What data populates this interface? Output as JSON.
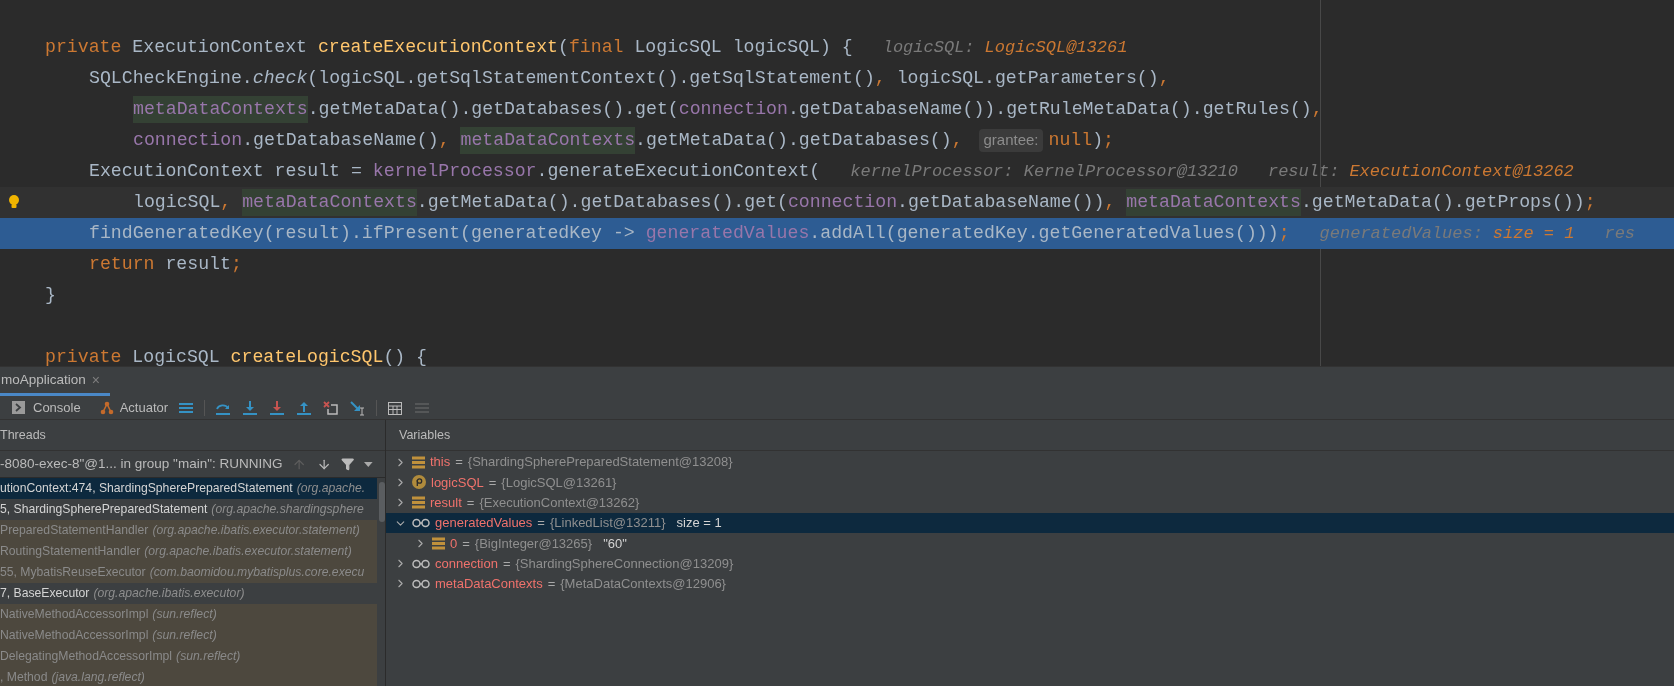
{
  "editor": {
    "lines": [
      {
        "kind": "top",
        "selected": false,
        "bulb": false,
        "tokens": [
          {
            "kind": "keyword",
            "text": "private "
          },
          {
            "kind": "plain",
            "text": "ExecutionContext "
          },
          {
            "kind": "declaration",
            "text": "createExecutionContext"
          },
          {
            "kind": "plain",
            "text": "("
          },
          {
            "kind": "keyword",
            "text": "final "
          },
          {
            "kind": "plain",
            "text": "LogicSQL logicSQL) {"
          },
          {
            "kind": "hint-label",
            "text": "logicSQL:"
          },
          {
            "kind": "hint-value",
            "text": "LogicSQL@13261"
          }
        ]
      },
      {
        "kind": "body",
        "selected": false,
        "bulb": false,
        "tokens": [
          {
            "kind": "plain",
            "text": "SQLCheckEngine."
          },
          {
            "kind": "static-call",
            "text": "check"
          },
          {
            "kind": "plain",
            "text": "(logicSQL.getSqlStatementContext().getSqlStatement()"
          },
          {
            "kind": "keyword",
            "text": ", "
          },
          {
            "kind": "plain",
            "text": "logicSQL.getParameters()"
          },
          {
            "kind": "keyword",
            "text": ","
          }
        ]
      },
      {
        "kind": "continuation",
        "selected": false,
        "bulb": false,
        "tokens": [
          {
            "kind": "field-usage",
            "text": "metaDataContexts"
          },
          {
            "kind": "plain",
            "text": ".getMetaData().getDatabases().get("
          },
          {
            "kind": "field",
            "text": "connection"
          },
          {
            "kind": "plain",
            "text": ".getDatabaseName()).getRuleMetaData().getRules()"
          },
          {
            "kind": "keyword",
            "text": ","
          }
        ]
      },
      {
        "kind": "continuation",
        "selected": false,
        "bulb": false,
        "tokens": [
          {
            "kind": "field",
            "text": "connection"
          },
          {
            "kind": "plain",
            "text": ".getDatabaseName()"
          },
          {
            "kind": "keyword",
            "text": ", "
          },
          {
            "kind": "field-usage",
            "text": "metaDataContexts"
          },
          {
            "kind": "plain",
            "text": ".getMetaData().getDatabases()"
          },
          {
            "kind": "keyword",
            "text": ", "
          },
          {
            "kind": "param-hint",
            "text": "grantee:"
          },
          {
            "kind": "keyword",
            "text": "null"
          },
          {
            "kind": "plain",
            "text": ")"
          },
          {
            "kind": "keyword",
            "text": ";"
          }
        ]
      },
      {
        "kind": "body",
        "selected": false,
        "bulb": false,
        "tokens": [
          {
            "kind": "plain",
            "text": "ExecutionContext result = "
          },
          {
            "kind": "field",
            "text": "kernelProcessor"
          },
          {
            "kind": "plain",
            "text": ".generateExecutionContext("
          },
          {
            "kind": "hint-label",
            "text": "kernelProcessor: KernelProcessor@13210"
          },
          {
            "kind": "hint-label",
            "text": "result:"
          },
          {
            "kind": "hint-value",
            "text": "ExecutionContext@13262"
          }
        ]
      },
      {
        "kind": "continuation",
        "selected": false,
        "bulb": true,
        "tokens": [
          {
            "kind": "plain",
            "text": "logicSQL"
          },
          {
            "kind": "keyword",
            "text": ", "
          },
          {
            "kind": "field-usage",
            "text": "metaDataContexts"
          },
          {
            "kind": "plain",
            "text": ".getMetaData().getDatabases().get("
          },
          {
            "kind": "field",
            "text": "connection"
          },
          {
            "kind": "plain",
            "text": ".getDatabaseName())"
          },
          {
            "kind": "keyword",
            "text": ", "
          },
          {
            "kind": "field-usage",
            "text": "metaDataContexts"
          },
          {
            "kind": "plain",
            "text": ".getMetaData().getProps())"
          },
          {
            "kind": "keyword",
            "text": ";"
          }
        ]
      },
      {
        "kind": "body",
        "selected": true,
        "bulb": false,
        "tokens": [
          {
            "kind": "plain",
            "text": "findGeneratedKey(result).ifPresent(generatedKey -> "
          },
          {
            "kind": "field",
            "text": "generatedValues"
          },
          {
            "kind": "plain",
            "text": ".addAll(generatedKey.getGeneratedValues()))"
          },
          {
            "kind": "keyword",
            "text": ";"
          },
          {
            "kind": "hint-label",
            "text": "generatedValues:"
          },
          {
            "kind": "hint-value",
            "text": "size = 1"
          },
          {
            "kind": "hint-label",
            "text": "res"
          }
        ]
      },
      {
        "kind": "body",
        "selected": false,
        "bulb": false,
        "tokens": [
          {
            "kind": "keyword",
            "text": "return "
          },
          {
            "kind": "plain",
            "text": "result"
          },
          {
            "kind": "keyword",
            "text": ";"
          }
        ]
      },
      {
        "kind": "top",
        "selected": false,
        "bulb": false,
        "tokens": [
          {
            "kind": "plain",
            "text": "}"
          }
        ]
      },
      {
        "kind": "top",
        "selected": false,
        "bulb": false
      },
      {
        "kind": "top",
        "selected": false,
        "bulb": false,
        "tokens": [
          {
            "kind": "keyword",
            "text": "private "
          },
          {
            "kind": "plain",
            "text": "LogicSQL "
          },
          {
            "kind": "declaration",
            "text": "createLogicSQL"
          },
          {
            "kind": "plain",
            "text": "() {"
          }
        ]
      }
    ]
  },
  "debug": {
    "session_tab": {
      "label": "moApplication",
      "close": "×"
    },
    "toolbar": {
      "buttons": [
        "Console",
        "Actuator"
      ]
    },
    "threads": {
      "title": "Threads",
      "selector": "-8080-exec-8\"@1... in group \"main\": RUNNING",
      "frames": [
        {
          "text": "utionContext:474, ShardingSpherePreparedStatement",
          "location": "(org.apache.",
          "library": false,
          "selected": true
        },
        {
          "text": "5, ShardingSpherePreparedStatement",
          "location": "(org.apache.shardingsphere",
          "library": false,
          "selected": false
        },
        {
          "text": "PreparedStatementHandler",
          "location": "(org.apache.ibatis.executor.statement)",
          "library": true,
          "selected": false
        },
        {
          "text": "RoutingStatementHandler",
          "location": "(org.apache.ibatis.executor.statement)",
          "library": true,
          "selected": false
        },
        {
          "text": "55, MybatisReuseExecutor",
          "location": "(com.baomidou.mybatisplus.core.execu",
          "library": true,
          "selected": false
        },
        {
          "text": "7, BaseExecutor",
          "location": "(org.apache.ibatis.executor)",
          "library": false,
          "selected": false
        },
        {
          "text": "NativeMethodAccessorImpl",
          "location": "(sun.reflect)",
          "library": true,
          "selected": false
        },
        {
          "text": "NativeMethodAccessorImpl",
          "location": "(sun.reflect)",
          "library": true,
          "selected": false
        },
        {
          "text": "DelegatingMethodAccessorImpl",
          "location": "(sun.reflect)",
          "library": true,
          "selected": false
        },
        {
          "text": ", Method",
          "location": "(java.lang.reflect)",
          "library": true,
          "selected": false
        }
      ]
    },
    "variables": {
      "title": "Variables",
      "items": [
        {
          "kind": "field",
          "name": "this",
          "separator": "=",
          "value": "{ShardingSpherePreparedStatement@13208}",
          "expanded": false,
          "selected": false
        },
        {
          "kind": "parameter",
          "name": "logicSQL",
          "separator": "=",
          "value": "{LogicSQL@13261}",
          "expanded": false,
          "selected": false
        },
        {
          "kind": "field",
          "name": "result",
          "separator": "=",
          "value": "{ExecutionContext@13262}",
          "expanded": false,
          "selected": false
        },
        {
          "kind": "watch",
          "name": "generatedValues",
          "separator": "=",
          "value": "{LinkedList@13211}",
          "extra": "size = 1",
          "expanded": true,
          "selected": true,
          "children": [
            {
              "kind": "field",
              "name": "0",
              "separator": "=",
              "value": "{BigInteger@13265}",
              "extra": "\"60\"",
              "expanded": false,
              "selected": false
            }
          ]
        },
        {
          "kind": "watch",
          "name": "connection",
          "separator": "=",
          "value": "{ShardingSphereConnection@13209}",
          "expanded": false,
          "selected": false
        },
        {
          "kind": "watch",
          "name": "metaDataContexts",
          "separator": "=",
          "value": "{MetaDataContexts@12906}",
          "expanded": false,
          "selected": false
        }
      ]
    }
  }
}
